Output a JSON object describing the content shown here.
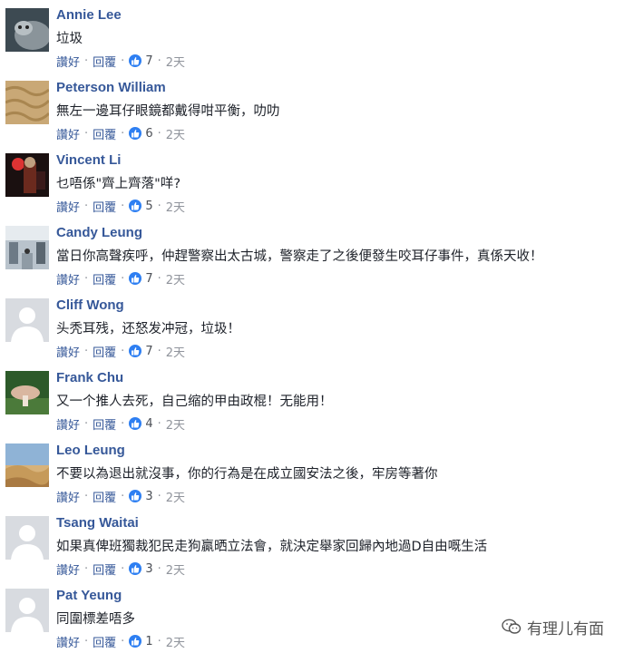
{
  "comments": [
    {
      "name": "Annie Lee",
      "text": "垃圾",
      "like_label": "讚好",
      "reply_label": "回覆",
      "likes": "7",
      "time": "2天",
      "avatar": "cat-photo-avatar"
    },
    {
      "name": "Peterson William",
      "text": "無左一邊耳仔眼鏡都戴得咁平衡，叻叻",
      "like_label": "讚好",
      "reply_label": "回覆",
      "likes": "6",
      "time": "2天",
      "avatar": "sand-texture-avatar"
    },
    {
      "name": "Vincent Li",
      "text": "乜唔係\"齊上齊落\"咩?",
      "like_label": "讚好",
      "reply_label": "回覆",
      "likes": "5",
      "time": "2天",
      "avatar": "dark-figure-avatar"
    },
    {
      "name": "Candy Leung",
      "text": "當日你高聲疾呼，仲趕警察出太古城，警察走了之後便發生咬耳仔事件，真係天收！",
      "like_label": "讚好",
      "reply_label": "回覆",
      "likes": "7",
      "time": "2天",
      "avatar": "mall-interior-avatar"
    },
    {
      "name": "Cliff Wong",
      "text": "头秃耳残，还怒发冲冠，垃圾！",
      "like_label": "讚好",
      "reply_label": "回覆",
      "likes": "7",
      "time": "2天",
      "avatar": "default-silhouette-avatar"
    },
    {
      "name": "Frank Chu",
      "text": "又一个推人去死，自己缩的甲由政棍！无能用！",
      "like_label": "讚好",
      "reply_label": "回覆",
      "likes": "4",
      "time": "2天",
      "avatar": "mushroom-avatar"
    },
    {
      "name": "Leo Leung",
      "text": "不要以為退出就沒事，你的行為是在成立國安法之後，牢房等著你",
      "like_label": "讚好",
      "reply_label": "回覆",
      "likes": "3",
      "time": "2天",
      "avatar": "desert-landscape-avatar"
    },
    {
      "name": "Tsang Waitai",
      "text": "如果真俾班獨裁犯民走狗贏晒立法會，就決定舉家回歸內地過D自由嘅生活",
      "like_label": "讚好",
      "reply_label": "回覆",
      "likes": "3",
      "time": "2天",
      "avatar": "default-silhouette-avatar"
    },
    {
      "name": "Pat Yeung",
      "text": "同圍標差唔多",
      "like_label": "讚好",
      "reply_label": "回覆",
      "likes": "1",
      "time": "2天",
      "avatar": "default-silhouette-avatar"
    }
  ],
  "separator": "·",
  "watermark": {
    "text": "有理儿有面",
    "icon": "wechat-icon"
  },
  "colors": {
    "name": "#365899",
    "like_badge": "#2e7ff2",
    "text": "#1d2129",
    "meta": "#90949c"
  }
}
